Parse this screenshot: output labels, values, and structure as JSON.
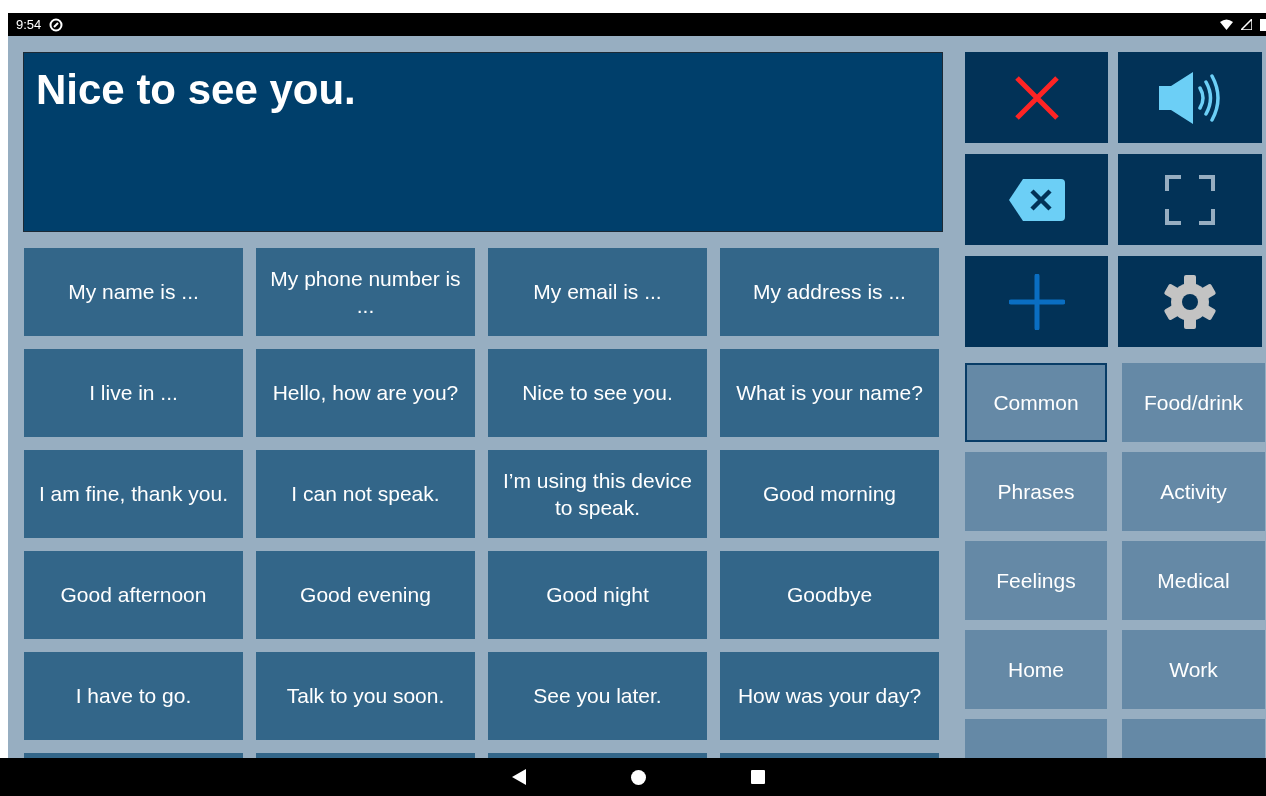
{
  "status_bar": {
    "time": "9:54"
  },
  "message": {
    "text": "Nice to see you."
  },
  "phrases": [
    {
      "text": "My name is ..."
    },
    {
      "text": "My phone number is ..."
    },
    {
      "text": "My email is ..."
    },
    {
      "text": "My address is ..."
    },
    {
      "text": "I live in ..."
    },
    {
      "text": "Hello, how are you?"
    },
    {
      "text": "Nice to see you."
    },
    {
      "text": "What is your name?"
    },
    {
      "text": "I am fine, thank you."
    },
    {
      "text": "I can not speak."
    },
    {
      "text": "I’m using this device to speak."
    },
    {
      "text": "Good morning"
    },
    {
      "text": "Good afternoon"
    },
    {
      "text": "Good evening"
    },
    {
      "text": "Good night"
    },
    {
      "text": "Goodbye"
    },
    {
      "text": "I have to go."
    },
    {
      "text": "Talk to you soon."
    },
    {
      "text": "See you later."
    },
    {
      "text": "How was your day?"
    }
  ],
  "actions": [
    {
      "kind": "clear"
    },
    {
      "kind": "speak"
    },
    {
      "kind": "backspace"
    },
    {
      "kind": "fullscreen"
    },
    {
      "kind": "add"
    },
    {
      "kind": "settings"
    }
  ],
  "categories": [
    {
      "label": "Common",
      "selected": true
    },
    {
      "label": "Food/drink",
      "selected": false
    },
    {
      "label": "Phrases",
      "selected": false
    },
    {
      "label": "Activity",
      "selected": false
    },
    {
      "label": "Feelings",
      "selected": false
    },
    {
      "label": "Medical",
      "selected": false
    },
    {
      "label": "Home",
      "selected": false
    },
    {
      "label": "Work",
      "selected": false
    }
  ]
}
